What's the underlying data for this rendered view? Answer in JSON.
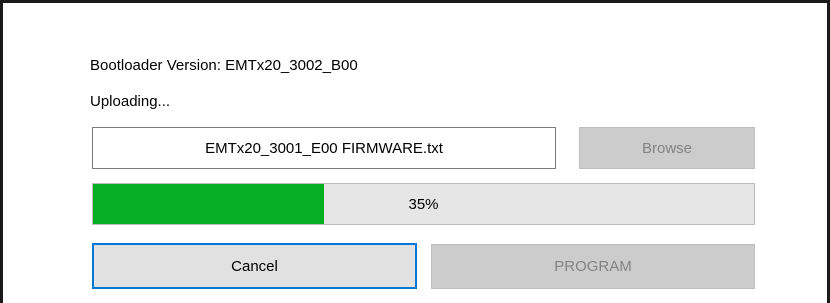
{
  "dialog": {
    "bootloader_version_text": "Bootloader Version: EMTx20_3002_B00",
    "status_text": "Uploading..."
  },
  "file_field": {
    "value": "EMTx20_3001_E00 FIRMWARE.txt"
  },
  "browse_button": {
    "label": "Browse",
    "enabled": false
  },
  "progress": {
    "percent": 35,
    "label": "35%",
    "fill_color": "#06b025"
  },
  "cancel_button": {
    "label": "Cancel",
    "focused": true,
    "focus_color": "#0078d7"
  },
  "program_button": {
    "label": "PROGRAM",
    "enabled": false
  }
}
